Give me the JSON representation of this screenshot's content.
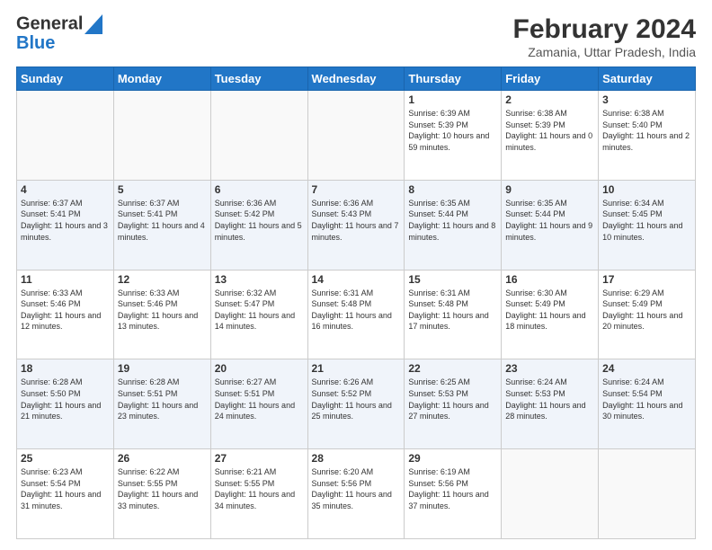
{
  "header": {
    "logo_general": "General",
    "logo_blue": "Blue",
    "month_year": "February 2024",
    "location": "Zamania, Uttar Pradesh, India"
  },
  "days_of_week": [
    "Sunday",
    "Monday",
    "Tuesday",
    "Wednesday",
    "Thursday",
    "Friday",
    "Saturday"
  ],
  "weeks": [
    [
      {
        "day": "",
        "info": ""
      },
      {
        "day": "",
        "info": ""
      },
      {
        "day": "",
        "info": ""
      },
      {
        "day": "",
        "info": ""
      },
      {
        "day": "1",
        "info": "Sunrise: 6:39 AM\nSunset: 5:39 PM\nDaylight: 10 hours and 59 minutes."
      },
      {
        "day": "2",
        "info": "Sunrise: 6:38 AM\nSunset: 5:39 PM\nDaylight: 11 hours and 0 minutes."
      },
      {
        "day": "3",
        "info": "Sunrise: 6:38 AM\nSunset: 5:40 PM\nDaylight: 11 hours and 2 minutes."
      }
    ],
    [
      {
        "day": "4",
        "info": "Sunrise: 6:37 AM\nSunset: 5:41 PM\nDaylight: 11 hours and 3 minutes."
      },
      {
        "day": "5",
        "info": "Sunrise: 6:37 AM\nSunset: 5:41 PM\nDaylight: 11 hours and 4 minutes."
      },
      {
        "day": "6",
        "info": "Sunrise: 6:36 AM\nSunset: 5:42 PM\nDaylight: 11 hours and 5 minutes."
      },
      {
        "day": "7",
        "info": "Sunrise: 6:36 AM\nSunset: 5:43 PM\nDaylight: 11 hours and 7 minutes."
      },
      {
        "day": "8",
        "info": "Sunrise: 6:35 AM\nSunset: 5:44 PM\nDaylight: 11 hours and 8 minutes."
      },
      {
        "day": "9",
        "info": "Sunrise: 6:35 AM\nSunset: 5:44 PM\nDaylight: 11 hours and 9 minutes."
      },
      {
        "day": "10",
        "info": "Sunrise: 6:34 AM\nSunset: 5:45 PM\nDaylight: 11 hours and 10 minutes."
      }
    ],
    [
      {
        "day": "11",
        "info": "Sunrise: 6:33 AM\nSunset: 5:46 PM\nDaylight: 11 hours and 12 minutes."
      },
      {
        "day": "12",
        "info": "Sunrise: 6:33 AM\nSunset: 5:46 PM\nDaylight: 11 hours and 13 minutes."
      },
      {
        "day": "13",
        "info": "Sunrise: 6:32 AM\nSunset: 5:47 PM\nDaylight: 11 hours and 14 minutes."
      },
      {
        "day": "14",
        "info": "Sunrise: 6:31 AM\nSunset: 5:48 PM\nDaylight: 11 hours and 16 minutes."
      },
      {
        "day": "15",
        "info": "Sunrise: 6:31 AM\nSunset: 5:48 PM\nDaylight: 11 hours and 17 minutes."
      },
      {
        "day": "16",
        "info": "Sunrise: 6:30 AM\nSunset: 5:49 PM\nDaylight: 11 hours and 18 minutes."
      },
      {
        "day": "17",
        "info": "Sunrise: 6:29 AM\nSunset: 5:49 PM\nDaylight: 11 hours and 20 minutes."
      }
    ],
    [
      {
        "day": "18",
        "info": "Sunrise: 6:28 AM\nSunset: 5:50 PM\nDaylight: 11 hours and 21 minutes."
      },
      {
        "day": "19",
        "info": "Sunrise: 6:28 AM\nSunset: 5:51 PM\nDaylight: 11 hours and 23 minutes."
      },
      {
        "day": "20",
        "info": "Sunrise: 6:27 AM\nSunset: 5:51 PM\nDaylight: 11 hours and 24 minutes."
      },
      {
        "day": "21",
        "info": "Sunrise: 6:26 AM\nSunset: 5:52 PM\nDaylight: 11 hours and 25 minutes."
      },
      {
        "day": "22",
        "info": "Sunrise: 6:25 AM\nSunset: 5:53 PM\nDaylight: 11 hours and 27 minutes."
      },
      {
        "day": "23",
        "info": "Sunrise: 6:24 AM\nSunset: 5:53 PM\nDaylight: 11 hours and 28 minutes."
      },
      {
        "day": "24",
        "info": "Sunrise: 6:24 AM\nSunset: 5:54 PM\nDaylight: 11 hours and 30 minutes."
      }
    ],
    [
      {
        "day": "25",
        "info": "Sunrise: 6:23 AM\nSunset: 5:54 PM\nDaylight: 11 hours and 31 minutes."
      },
      {
        "day": "26",
        "info": "Sunrise: 6:22 AM\nSunset: 5:55 PM\nDaylight: 11 hours and 33 minutes."
      },
      {
        "day": "27",
        "info": "Sunrise: 6:21 AM\nSunset: 5:55 PM\nDaylight: 11 hours and 34 minutes."
      },
      {
        "day": "28",
        "info": "Sunrise: 6:20 AM\nSunset: 5:56 PM\nDaylight: 11 hours and 35 minutes."
      },
      {
        "day": "29",
        "info": "Sunrise: 6:19 AM\nSunset: 5:56 PM\nDaylight: 11 hours and 37 minutes."
      },
      {
        "day": "",
        "info": ""
      },
      {
        "day": "",
        "info": ""
      }
    ]
  ]
}
